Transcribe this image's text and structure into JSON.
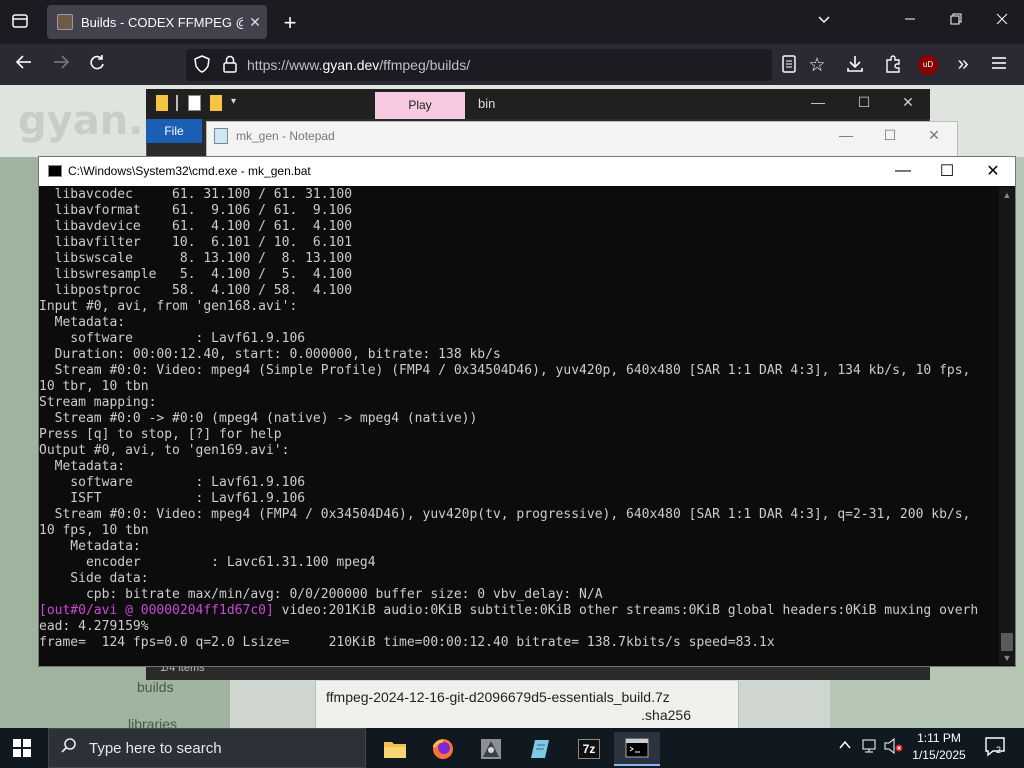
{
  "browser": {
    "tab_title": "Builds - CODEX FFMPEG @ gyan.dev",
    "tab_close": "✕",
    "new_tab": "+",
    "url_prefix": "https://www.",
    "url_domain": "gyan.dev",
    "url_path": "/ffmpeg/builds/",
    "extension_badge": "uD"
  },
  "page": {
    "logo_text": "gyan.dev",
    "nav_builds": "builds",
    "nav_libraries": "libraries",
    "file_name_line1": "ffmpeg-2024-12-16-git-d2096679d5-essentials_build.7z",
    "file_name_line2": ".sha256"
  },
  "explorer": {
    "play_tab": "Play",
    "folder_name": "bin",
    "file_menu": "File",
    "status_items": "1/4 items"
  },
  "notepad": {
    "title": "mk_gen - Notepad"
  },
  "cmd": {
    "title": "C:\\Windows\\System32\\cmd.exe - mk_gen.bat",
    "lines": [
      "  libavcodec     61. 31.100 / 61. 31.100",
      "  libavformat    61.  9.106 / 61.  9.106",
      "  libavdevice    61.  4.100 / 61.  4.100",
      "  libavfilter    10.  6.101 / 10.  6.101",
      "  libswscale      8. 13.100 /  8. 13.100",
      "  libswresample   5.  4.100 /  5.  4.100",
      "  libpostproc    58.  4.100 / 58.  4.100",
      "Input #0, avi, from 'gen168.avi':",
      "  Metadata:",
      "    software        : Lavf61.9.106",
      "  Duration: 00:00:12.40, start: 0.000000, bitrate: 138 kb/s",
      "  Stream #0:0: Video: mpeg4 (Simple Profile) (FMP4 / 0x34504D46), yuv420p, 640x480 [SAR 1:1 DAR 4:3], 134 kb/s, 10 fps,",
      "10 tbr, 10 tbn",
      "Stream mapping:",
      "  Stream #0:0 -> #0:0 (mpeg4 (native) -> mpeg4 (native))",
      "Press [q] to stop, [?] for help",
      "Output #0, avi, to 'gen169.avi':",
      "  Metadata:",
      "    software        : Lavf61.9.106",
      "    ISFT            : Lavf61.9.106",
      "  Stream #0:0: Video: mpeg4 (FMP4 / 0x34504D46), yuv420p(tv, progressive), 640x480 [SAR 1:1 DAR 4:3], q=2-31, 200 kb/s,",
      "10 fps, 10 tbn",
      "    Metadata:",
      "      encoder         : Lavc61.31.100 mpeg4",
      "    Side data:",
      "      cpb: bitrate max/min/avg: 0/0/200000 buffer size: 0 vbv_delay: N/A"
    ],
    "mux_prefix": "[out#0/avi @ 00000204ff1d67c0]",
    "mux_rest": " video:201KiB audio:0KiB subtitle:0KiB other streams:0KiB global headers:0KiB muxing overh",
    "mux_line2": "ead: 4.279159%",
    "frame_line": "frame=  124 fps=0.0 q=2.0 Lsize=     210KiB time=00:00:12.40 bitrate= 138.7kbits/s speed=83.1x"
  },
  "taskbar": {
    "search_placeholder": "Type here to search",
    "time": "1:11 PM",
    "date": "1/15/2025",
    "notification_count": "2",
    "sevenzip_label": "7z"
  }
}
